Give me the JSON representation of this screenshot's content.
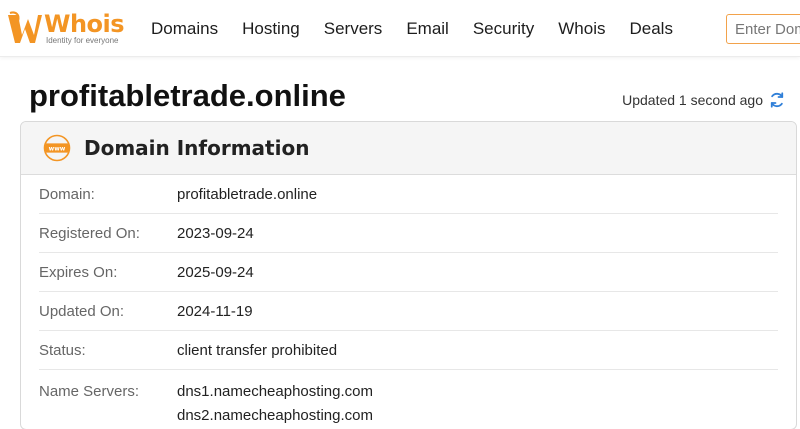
{
  "brand": {
    "name": "Whois",
    "tagline": "Identity for everyone",
    "color": "#f39524"
  },
  "nav": {
    "items": [
      "Domains",
      "Hosting",
      "Servers",
      "Email",
      "Security",
      "Whois",
      "Deals"
    ]
  },
  "search": {
    "placeholder": "Enter Domain"
  },
  "page": {
    "domain": "profitabletrade.online",
    "updated": "Updated 1 second ago"
  },
  "card": {
    "title": "Domain Information",
    "icon": "www-icon",
    "rows": [
      {
        "label": "Domain:",
        "value": "profitabletrade.online"
      },
      {
        "label": "Registered On:",
        "value": "2023-09-24"
      },
      {
        "label": "Expires On:",
        "value": "2025-09-24"
      },
      {
        "label": "Updated On:",
        "value": "2024-11-19"
      },
      {
        "label": "Status:",
        "value": "client transfer prohibited"
      }
    ],
    "name_servers": {
      "label": "Name Servers:",
      "values": [
        "dns1.namecheaphosting.com",
        "dns2.namecheaphosting.com"
      ]
    }
  },
  "colors": {
    "accent": "#f39524",
    "refresh": "#2f7fd8"
  }
}
